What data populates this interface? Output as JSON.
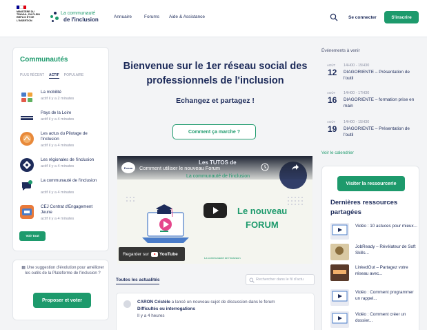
{
  "header": {
    "gov_text": "Ministère du travail, du plein emploi et de l'insertion",
    "brand_line1": "La communauté",
    "brand_line2": "de l'inclusion",
    "nav": [
      "Annuaire",
      "Forums",
      "Aide & Assistance"
    ],
    "login": "Se connecter",
    "signup": "S'inscrire",
    "colors": {
      "brand_green": "#1d9a6c",
      "navy": "#1d2b5a"
    }
  },
  "communities": {
    "title": "Communautés",
    "tabs": [
      "Plus récent",
      "Actif",
      "Populaire"
    ],
    "active_tab": "Actif",
    "items": [
      {
        "name": "La mobilité",
        "activity": "actif il y a 2 minutes"
      },
      {
        "name": "Pays de la Loire",
        "activity": "actif il y a 4 minutes"
      },
      {
        "name": "Les actus du Pilotage de l'inclusion",
        "activity": "actif il y a 4 minutes"
      },
      {
        "name": "Les régionales de l'inclusion",
        "activity": "actif il y a 4 minutes"
      },
      {
        "name": "La communauté de l'inclusion",
        "activity": "actif il y a 4 minutes"
      },
      {
        "name": "CEJ Contrat d'Engagement Jeune",
        "activity": "actif il y a 4 minutes"
      }
    ],
    "see_all": "Voir tout"
  },
  "suggestion": {
    "text": "Une suggestion d'évolution pour améliorer les outils de la Plateforme de l'inclusion ?",
    "button": "Proposer et voter"
  },
  "hero": {
    "title": "Bienvenue sur le 1er réseau social des professionnels de l'inclusion",
    "subtitle": "Echangez et partagez !",
    "how_button": "Comment ça marche ?"
  },
  "video": {
    "title": "Comment utiliser le nouveau Forum",
    "badge": "Forum",
    "overlay_big": "Les TUTOS de",
    "overlay_comm": "La communauté de l'inclusion",
    "forum_line1": "Le nouveau",
    "forum_line2": "FORUM",
    "watch_on": "Regarder sur",
    "youtube": "YouTube",
    "footer_logo": "La communauté de l'inclusion"
  },
  "news": {
    "tab": "Toutes les actualités",
    "search_placeholder": "Rechercher dans le fil d'actu",
    "item": {
      "author": "CARON Cristèle",
      "action": " a lancé un nouveau sujet de discussion dans le forum",
      "subject": "Difficultés ou interrogations",
      "time": "Il y a 4 heures"
    }
  },
  "events": {
    "title": "Événements à venir",
    "items": [
      {
        "month": "AOÛT",
        "day": "12",
        "time": "14H00 - 15H30",
        "name": "DIAGORIENTE – Présentation de l'outil"
      },
      {
        "month": "AOÛT",
        "day": "16",
        "time": "14H00 - 17H30",
        "name": "DIAGORIENTE – formation prise en main"
      },
      {
        "month": "AOÛT",
        "day": "19",
        "time": "14H00 - 15H30",
        "name": "DIAGORIENTE – Présentation de l'outil"
      }
    ],
    "calendar_link": "Voir le calendrier"
  },
  "resources": {
    "visit_button": "Visiter la ressourcerie",
    "title": "Dernières ressources partagées",
    "items": [
      {
        "name": "Vidéo : 10 astuces pour mieux..."
      },
      {
        "name": "JobReady – Révélateur de Soft Skills..."
      },
      {
        "name": "LinkedOut – Partagez votre réseau avec..."
      },
      {
        "name": "Vidéo : Comment programmer un rappel..."
      },
      {
        "name": "Vidéo : Comment créer un dossier..."
      }
    ]
  }
}
